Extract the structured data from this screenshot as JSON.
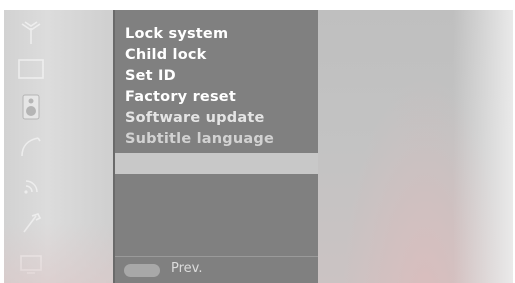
{
  "menu": {
    "items": [
      {
        "label": "Lock system"
      },
      {
        "label": "Child lock"
      },
      {
        "label": "Set ID"
      },
      {
        "label": "Factory reset"
      },
      {
        "label": "Software update"
      },
      {
        "label": "Subtitle language"
      }
    ],
    "selected_item": ""
  },
  "footer": {
    "prev_label": "Prev."
  },
  "sidebar": {
    "icons": [
      "antenna-icon",
      "screen-icon",
      "speaker-icon",
      "network-icon",
      "wireless-icon",
      "tools-icon",
      "tv-icon"
    ]
  },
  "colors": {
    "menu_background": "#808080",
    "highlight": "#c8c8c8",
    "text": "#ffffff"
  }
}
